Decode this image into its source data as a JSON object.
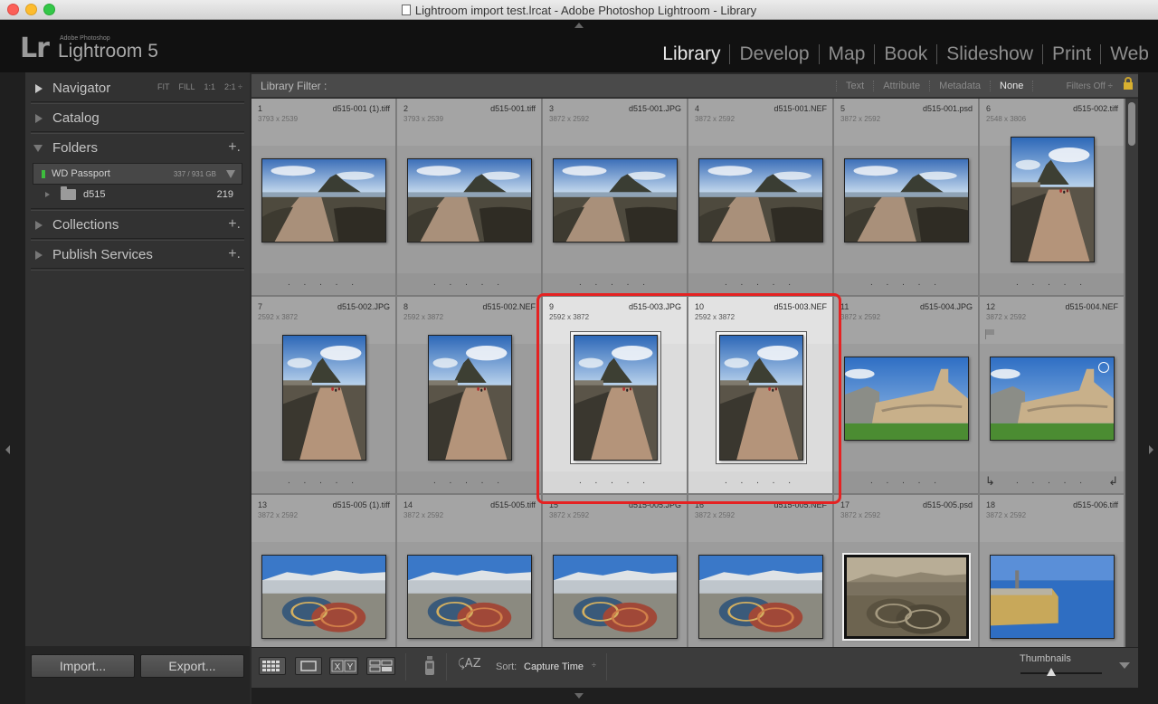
{
  "window": {
    "title": "Lightroom import test.lrcat - Adobe Photoshop Lightroom - Library"
  },
  "brand": {
    "mark": "Lr",
    "small": "Adobe Photoshop",
    "name": "Lightroom 5"
  },
  "modules": [
    {
      "label": "Library",
      "active": true
    },
    {
      "label": "Develop",
      "active": false
    },
    {
      "label": "Map",
      "active": false
    },
    {
      "label": "Book",
      "active": false
    },
    {
      "label": "Slideshow",
      "active": false
    },
    {
      "label": "Print",
      "active": false
    },
    {
      "label": "Web",
      "active": false
    }
  ],
  "left": {
    "navigator": {
      "label": "Navigator",
      "options": [
        "FIT",
        "FILL",
        "1:1",
        "2:1 ÷"
      ]
    },
    "catalog": {
      "label": "Catalog"
    },
    "folders": {
      "label": "Folders",
      "plus": "+."
    },
    "volume": {
      "name": "WD Passport",
      "size": "337 / 931 GB"
    },
    "folder": {
      "name": "d515",
      "count": "219"
    },
    "collections": {
      "label": "Collections",
      "plus": "+."
    },
    "publish": {
      "label": "Publish Services",
      "plus": "+."
    },
    "import_label": "Import...",
    "export_label": "Export..."
  },
  "filter": {
    "label": "Library Filter :",
    "options": [
      {
        "label": "Text",
        "active": false
      },
      {
        "label": "Attribute",
        "active": false
      },
      {
        "label": "Metadata",
        "active": false
      },
      {
        "label": "None",
        "active": true
      }
    ],
    "status": "Filters Off ÷"
  },
  "grid": {
    "cells": [
      {
        "index": "1",
        "name": "d515-001 (1).tiff",
        "dims": "3793 x 2539",
        "orient": "land",
        "scene": "causeway",
        "selected": false
      },
      {
        "index": "2",
        "name": "d515-001.tiff",
        "dims": "3793 x 2539",
        "orient": "land",
        "scene": "causeway",
        "selected": false
      },
      {
        "index": "3",
        "name": "d515-001.JPG",
        "dims": "3872 x 2592",
        "orient": "land",
        "scene": "causeway",
        "selected": false
      },
      {
        "index": "4",
        "name": "d515-001.NEF",
        "dims": "3872 x 2592",
        "orient": "land",
        "scene": "causeway",
        "selected": false
      },
      {
        "index": "5",
        "name": "d515-001.psd",
        "dims": "3872 x 2592",
        "orient": "land",
        "scene": "causeway",
        "selected": false
      },
      {
        "index": "6",
        "name": "d515-002.tiff",
        "dims": "2548 x 3806",
        "orient": "port",
        "scene": "path",
        "selected": false
      },
      {
        "index": "7",
        "name": "d515-002.JPG",
        "dims": "2592 x 3872",
        "orient": "port",
        "scene": "path",
        "selected": false
      },
      {
        "index": "8",
        "name": "d515-002.NEF",
        "dims": "2592 x 3872",
        "orient": "port",
        "scene": "path",
        "selected": false
      },
      {
        "index": "9",
        "name": "d515-003.JPG",
        "dims": "2592 x 3872",
        "orient": "port",
        "scene": "path",
        "selected": true
      },
      {
        "index": "10",
        "name": "d515-003.NEF",
        "dims": "2592 x 3872",
        "orient": "port",
        "scene": "path",
        "selected": true
      },
      {
        "index": "11",
        "name": "d515-004.JPG",
        "dims": "3872 x 2592",
        "orient": "land",
        "scene": "wall",
        "selected": false
      },
      {
        "index": "12",
        "name": "d515-004.NEF",
        "dims": "3872 x 2592",
        "orient": "land",
        "scene": "wall",
        "selected": false,
        "flag": true
      },
      {
        "index": "13",
        "name": "d515-005 (1).tiff",
        "dims": "3872 x 2592",
        "orient": "land",
        "scene": "pots",
        "selected": false
      },
      {
        "index": "14",
        "name": "d515-005.tiff",
        "dims": "3872 x 2592",
        "orient": "land",
        "scene": "pots",
        "selected": false
      },
      {
        "index": "15",
        "name": "d515-005.JPG",
        "dims": "3872 x 2592",
        "orient": "land",
        "scene": "pots",
        "selected": false
      },
      {
        "index": "16",
        "name": "d515-005.NEF",
        "dims": "3872 x 2592",
        "orient": "land",
        "scene": "pots",
        "selected": false
      },
      {
        "index": "17",
        "name": "d515-005.psd",
        "dims": "3872 x 2592",
        "orient": "land",
        "scene": "pots-sepia",
        "selected": false
      },
      {
        "index": "18",
        "name": "d515-006.tiff",
        "dims": "3872 x 2592",
        "orient": "land",
        "scene": "harbour",
        "selected": false
      }
    ],
    "dots": ". . . . ."
  },
  "toolbar": {
    "view_icons": [
      "grid-view-icon",
      "loupe-view-icon",
      "compare-view-icon",
      "survey-view-icon"
    ],
    "compare_label": "X|Y",
    "sort_label": "Sort:",
    "sort_value": "Capture Time",
    "sort_caret": "÷",
    "thumbnails_label": "Thumbnails",
    "thumbnail_size": 0.38
  },
  "colors": {
    "highlight": "#e52222",
    "active_module": "#e8e8e8",
    "lock": "#d8b030"
  }
}
